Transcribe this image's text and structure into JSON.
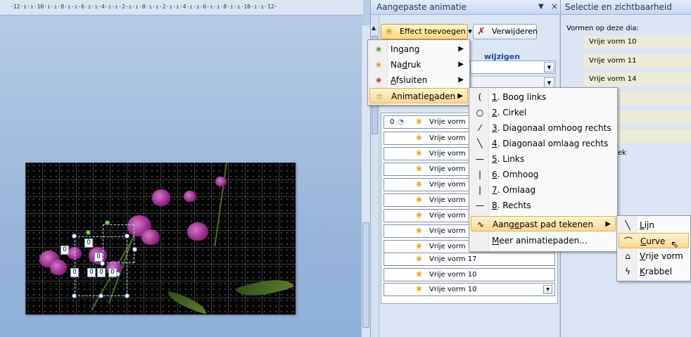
{
  "ruler": {
    "text": "·12·ı·ı·10·ı·ı·8·ı·ı·6·ı·ı·4·ı·ı·2·ı·ı·0·ı·ı·2·ı·ı·4·ı·ı·6·ı·ı·8·ı·ı·10·ı·ı·12·"
  },
  "slide": {
    "tags": [
      "0",
      "0",
      "0",
      "0",
      "0",
      "0",
      "0"
    ]
  },
  "anim_pane": {
    "title": "Aangepaste animatie",
    "dropdown_glyph": "▼",
    "close_glyph": "×",
    "add_effect_label": "Effect toevoegen",
    "add_effect_caret": "▾",
    "remove_label": "Verwijderen",
    "modify_label": "wijzigen",
    "rows": [
      {
        "num": "0",
        "text": "Vrije vorm 1"
      },
      {
        "num": "",
        "text": "Vrije vorm 1"
      },
      {
        "num": "",
        "text": "Vrije vorm 1"
      },
      {
        "num": "",
        "text": "Vrije vorm 1"
      },
      {
        "num": "",
        "text": "Vrije vorm 1"
      },
      {
        "num": "",
        "text": "Vrije vorm 1"
      },
      {
        "num": "",
        "text": "Vrije vorm 1"
      },
      {
        "num": "",
        "text": "Vrije vorm 1"
      },
      {
        "num": "",
        "text": "Vrije vorm 1"
      },
      {
        "num": "",
        "text": "Vrije vorm 17"
      },
      {
        "num": "",
        "text": "Vrije vorm 10"
      },
      {
        "num": "",
        "text": "Vrije vorm 10"
      }
    ]
  },
  "menu_effects": {
    "items": [
      {
        "pre": "In",
        "acc": "g",
        "post": "ang"
      },
      {
        "pre": "Na",
        "acc": "d",
        "post": "ruk"
      },
      {
        "pre": "",
        "acc": "A",
        "post": "fsluiten"
      },
      {
        "pre": "Animatie",
        "acc": "p",
        "post": "aden"
      }
    ]
  },
  "menu_paths": {
    "items": [
      {
        "glyph": "(",
        "acc": "1",
        "label": ". Boog links"
      },
      {
        "glyph": "○",
        "acc": "2",
        "label": ". Cirkel"
      },
      {
        "glyph": "⁄",
        "acc": "3",
        "label": ". Diagonaal omhoog rechts"
      },
      {
        "glyph": "╲",
        "acc": "4",
        "label": ". Diagonaal omlaag rechts"
      },
      {
        "glyph": "—",
        "acc": "5",
        "label": ". Links"
      },
      {
        "glyph": "|",
        "acc": "6",
        "label": ". Omhoog"
      },
      {
        "glyph": "|",
        "acc": "7",
        "label": ". Omlaag"
      },
      {
        "glyph": "—",
        "acc": "8",
        "label": ". Rechts"
      }
    ],
    "custom": {
      "pre": "Aang",
      "acc": "e",
      "post": "past pad tekenen"
    },
    "more": {
      "pre": "",
      "acc": "M",
      "post": "eer animatiepaden..."
    }
  },
  "menu_draw": {
    "items": [
      {
        "pre": "",
        "acc": "L",
        "post": "ijn"
      },
      {
        "pre": "",
        "acc": "C",
        "post": "urve"
      },
      {
        "pre": "",
        "acc": "V",
        "post": "rije vorm"
      },
      {
        "pre": "",
        "acc": "K",
        "post": "rabbel"
      }
    ]
  },
  "selection_pane": {
    "title": "Selectie en zichtbaarheid",
    "subtitle": "Vormen op deze dia:",
    "items": [
      "Vrije vorm 10",
      "Vrije vorm 11",
      "Vrije vorm 14",
      "m 19",
      "m 17",
      "m 18"
    ],
    "partial_text": "ek"
  },
  "colors": {
    "menu_highlight": "#ffd890",
    "pane_bg": "#dbe5f3",
    "slide_bg": "#050505"
  }
}
